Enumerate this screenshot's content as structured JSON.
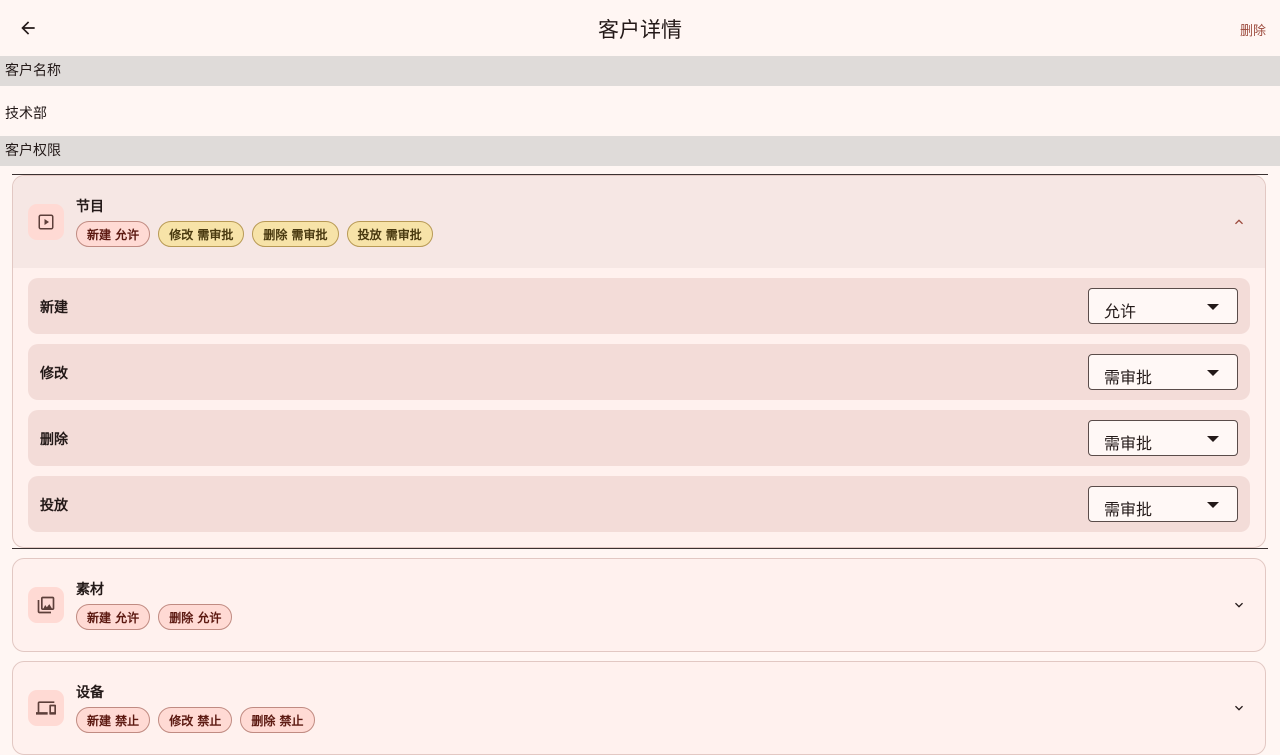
{
  "header": {
    "title": "客户详情",
    "delete_label": "删除"
  },
  "customer": {
    "name_label": "客户名称",
    "name_value": "技术部",
    "permissions_label": "客户权限"
  },
  "permissions": [
    {
      "title": "节目",
      "icon": "play-square-icon",
      "expanded": true,
      "chips": [
        {
          "text": "新建 允许",
          "status": "allow"
        },
        {
          "text": "修改 需审批",
          "status": "approve"
        },
        {
          "text": "删除 需审批",
          "status": "approve"
        },
        {
          "text": "投放 需审批",
          "status": "approve"
        }
      ],
      "rows": [
        {
          "label": "新建",
          "value": "允许"
        },
        {
          "label": "修改",
          "value": "需审批"
        },
        {
          "label": "删除",
          "value": "需审批"
        },
        {
          "label": "投放",
          "value": "需审批"
        }
      ]
    },
    {
      "title": "素材",
      "icon": "photo-library-icon",
      "expanded": false,
      "chips": [
        {
          "text": "新建 允许",
          "status": "allow"
        },
        {
          "text": "删除 允许",
          "status": "allow"
        }
      ]
    },
    {
      "title": "设备",
      "icon": "devices-icon",
      "expanded": false,
      "chips": [
        {
          "text": "新建 禁止",
          "status": "deny"
        },
        {
          "text": "修改 禁止",
          "status": "deny"
        },
        {
          "text": "删除 禁止",
          "status": "deny"
        }
      ]
    }
  ],
  "colors": {
    "background": "#fff6f3",
    "section_header": "#dfdbd9",
    "accent": "#9c4a3c",
    "allow_chip": "#ffdad4",
    "approve_chip": "#f7e3a8"
  }
}
